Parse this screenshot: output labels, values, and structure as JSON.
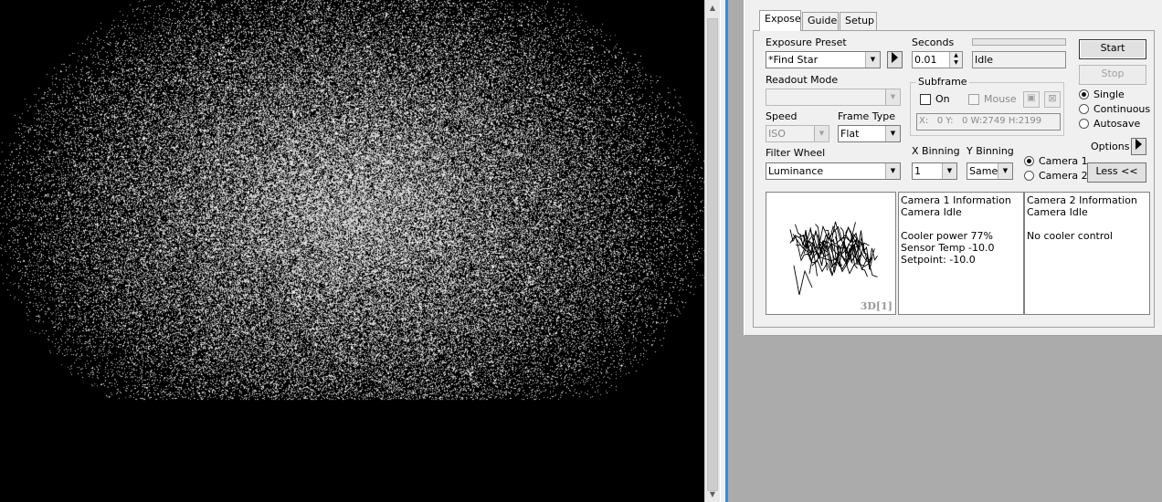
{
  "tabs": [
    {
      "label": "Expose"
    },
    {
      "label": "Guide"
    },
    {
      "label": "Setup"
    }
  ],
  "expose": {
    "exposure_preset_label": "Exposure Preset",
    "exposure_preset_value": "*Find Star",
    "seconds_label": "Seconds",
    "seconds_value": "0.01",
    "status_value": "Idle",
    "progress": 0,
    "start_label": "Start",
    "stop_label": "Stop",
    "readout_mode_label": "Readout Mode",
    "readout_mode_value": "",
    "subframe_label": "Subframe",
    "subframe_on_label": "On",
    "subframe_mouse_label": "Mouse",
    "subframe_coords": "X:   0 Y:   0 W:2749 H:2199",
    "speed_label": "Speed",
    "speed_value": "ISO",
    "frame_type_label": "Frame Type",
    "frame_type_value": "Flat",
    "mode_options": [
      "Single",
      "Continuous",
      "Autosave"
    ],
    "mode_selected": "Single",
    "options_label": "Options",
    "filter_wheel_label": "Filter Wheel",
    "filter_wheel_value": "Luminance",
    "x_binning_label": "X Binning",
    "x_binning_value": "1",
    "y_binning_label": "Y Binning",
    "y_binning_value": "Same",
    "camera_options": [
      "Camera 1",
      "Camera 2"
    ],
    "camera_selected": "Camera 1",
    "less_label": "Less <<"
  },
  "preview": {
    "label": "3D[1]"
  },
  "camera1_info": {
    "title": "Camera 1 Information",
    "status": "Camera Idle",
    "cooler_power": "Cooler power 77%",
    "sensor_temp": "Sensor Temp -10.0",
    "setpoint": "Setpoint: -10.0"
  },
  "camera2_info": {
    "title": "Camera 2 Information",
    "status": "Camera Idle",
    "cooler": "No cooler control"
  },
  "colors": {
    "image_background": "#000000",
    "panel_background": "#f0f0f0",
    "splitter_accent": "#3a8ad6"
  }
}
